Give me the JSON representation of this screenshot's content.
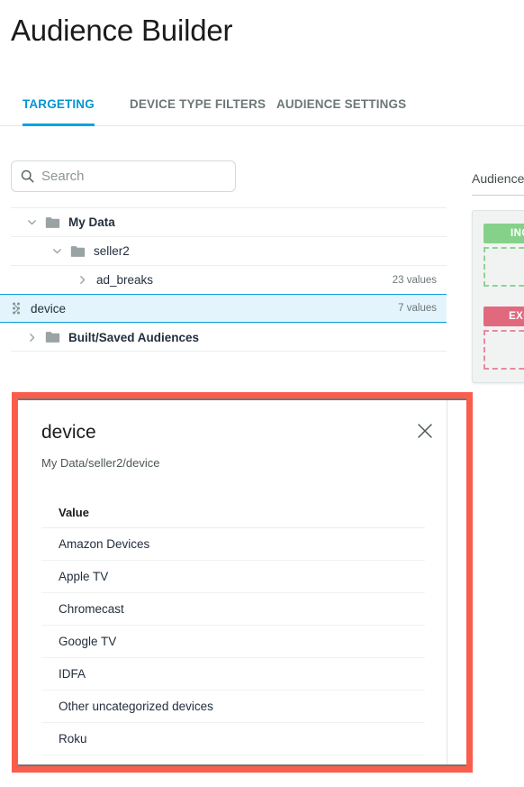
{
  "header": {
    "title": "Audience Builder"
  },
  "tabs": [
    {
      "label": "TARGETING",
      "active": true
    },
    {
      "label": "DEVICE TYPE FILTERS",
      "active": false
    },
    {
      "label": "AUDIENCE SETTINGS",
      "active": false
    }
  ],
  "search": {
    "placeholder": "Search",
    "value": "",
    "icon": "search-icon"
  },
  "tree": {
    "rows": [
      {
        "label": "My Data",
        "depth": 0,
        "expanded": true,
        "bold": true,
        "folder": true,
        "count": "",
        "selected": false,
        "handle": false
      },
      {
        "label": "seller2",
        "depth": 1,
        "expanded": true,
        "bold": false,
        "folder": true,
        "count": "",
        "selected": false,
        "handle": false
      },
      {
        "label": "ad_breaks",
        "depth": 2,
        "expanded": false,
        "bold": false,
        "folder": false,
        "count": "23 values",
        "selected": false,
        "handle": false
      },
      {
        "label": "device",
        "depth": 2,
        "expanded": false,
        "bold": false,
        "folder": false,
        "count": "7 values",
        "selected": true,
        "handle": true
      },
      {
        "label": "Built/Saved Audiences",
        "depth": 0,
        "expanded": false,
        "bold": true,
        "folder": true,
        "count": "",
        "selected": false,
        "handle": false
      }
    ]
  },
  "audience_panel": {
    "title": "Audience",
    "include_label": "INCLUDE",
    "exclude_label": "EXCLUDE",
    "include_color": "#85d18a",
    "exclude_color": "#e0697e"
  },
  "detail": {
    "title": "device",
    "path": "My Data/seller2/device",
    "close_icon": "close-icon",
    "column_header": "Value",
    "values": [
      "Amazon Devices",
      "Apple TV",
      "Chromecast",
      "Google TV",
      "IDFA",
      "Other uncategorized devices",
      "Roku"
    ]
  },
  "annotation": {
    "highlight_color": "#fb5d4c"
  }
}
